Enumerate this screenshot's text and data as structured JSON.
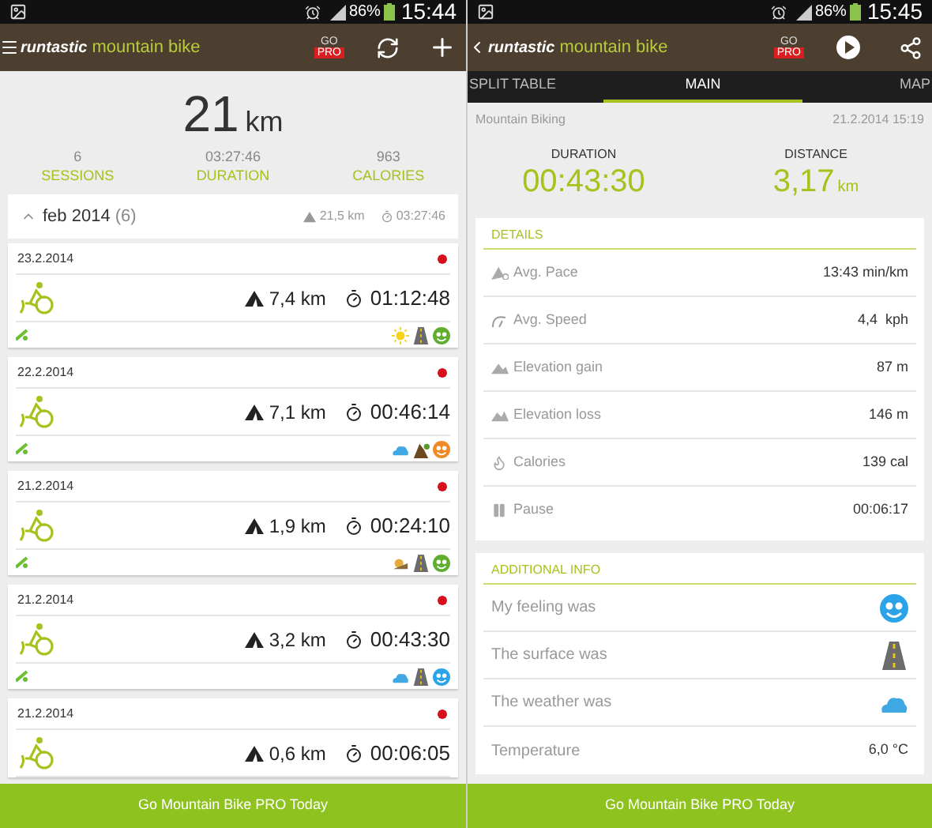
{
  "screens": [
    {
      "status_bar": {
        "battery": "86%",
        "time": "15:44"
      },
      "app_bar": {
        "brand": "runtastic",
        "product": "mountain bike",
        "badge_top": "GO",
        "badge_bottom": "PRO"
      },
      "summary": {
        "distance": "21",
        "unit": "km",
        "stats": [
          {
            "value": "6",
            "label": "SESSIONS"
          },
          {
            "value": "03:27:46",
            "label": "DURATION"
          },
          {
            "value": "963",
            "label": "CALORIES"
          }
        ]
      },
      "month": {
        "expanded": true,
        "label": "feb 2014",
        "count": "(6)",
        "distance": "21,5 km",
        "duration": "03:27:46"
      },
      "sessions": [
        {
          "date": "23.2.2014",
          "distance": "7,4 km",
          "duration": "01:12:48",
          "conditions": [
            {
              "kind": "sun"
            },
            {
              "kind": "road"
            },
            {
              "kind": "face",
              "color": "#5fae2e"
            }
          ]
        },
        {
          "date": "22.2.2014",
          "distance": "7,1 km",
          "duration": "00:46:14",
          "conditions": [
            {
              "kind": "cloud"
            },
            {
              "kind": "trail"
            },
            {
              "kind": "face",
              "color": "#f08a24"
            }
          ]
        },
        {
          "date": "21.2.2014",
          "distance": "1,9 km",
          "duration": "00:24:10",
          "conditions": [
            {
              "kind": "dusk"
            },
            {
              "kind": "road"
            },
            {
              "kind": "face",
              "color": "#5fae2e"
            }
          ]
        },
        {
          "date": "21.2.2014",
          "distance": "3,2 km",
          "duration": "00:43:30",
          "conditions": [
            {
              "kind": "cloud"
            },
            {
              "kind": "road"
            },
            {
              "kind": "face",
              "color": "#2aa3e8"
            }
          ]
        },
        {
          "date": "21.2.2014",
          "distance": "0,6 km",
          "duration": "00:06:05"
        }
      ],
      "banner": "Go Mountain Bike PRO Today"
    },
    {
      "status_bar": {
        "battery": "86%",
        "time": "15:45"
      },
      "app_bar": {
        "brand": "runtastic",
        "product": "mountain bike",
        "badge_top": "GO",
        "badge_bottom": "PRO"
      },
      "tabs": [
        {
          "label": "SPLIT TABLE",
          "selected": false
        },
        {
          "label": "MAIN",
          "selected": true
        },
        {
          "label": "MAP",
          "selected": false
        }
      ],
      "activity": "Mountain Biking",
      "date": "21.2.2014 15:19",
      "duration": {
        "label": "DURATION",
        "value": "00:43:30"
      },
      "distance": {
        "label": "DISTANCE",
        "value": "3,17",
        "unit": "km"
      },
      "details": {
        "title": "DETAILS",
        "rows": [
          {
            "label": "Avg. Pace",
            "value": "13:43 min/km"
          },
          {
            "label": "Avg. Speed",
            "value": "4,4  kph"
          },
          {
            "label": "Elevation gain",
            "value": "87 m"
          },
          {
            "label": "Elevation loss",
            "value": "146 m"
          },
          {
            "label": "Calories",
            "value": "139 cal"
          },
          {
            "label": "Pause",
            "value": "00:06:17"
          }
        ]
      },
      "additional_info": {
        "title": "ADDITIONAL INFO",
        "rows": [
          {
            "label": "My feeling was",
            "kind": "face",
            "color": "#2aa3e8"
          },
          {
            "label": "The surface was",
            "kind": "road"
          },
          {
            "label": "The weather was",
            "kind": "cloud"
          },
          {
            "label": "Temperature",
            "kind": "text",
            "value": "6,0 °C"
          }
        ]
      },
      "banner": "Go Mountain Bike PRO Today"
    }
  ]
}
